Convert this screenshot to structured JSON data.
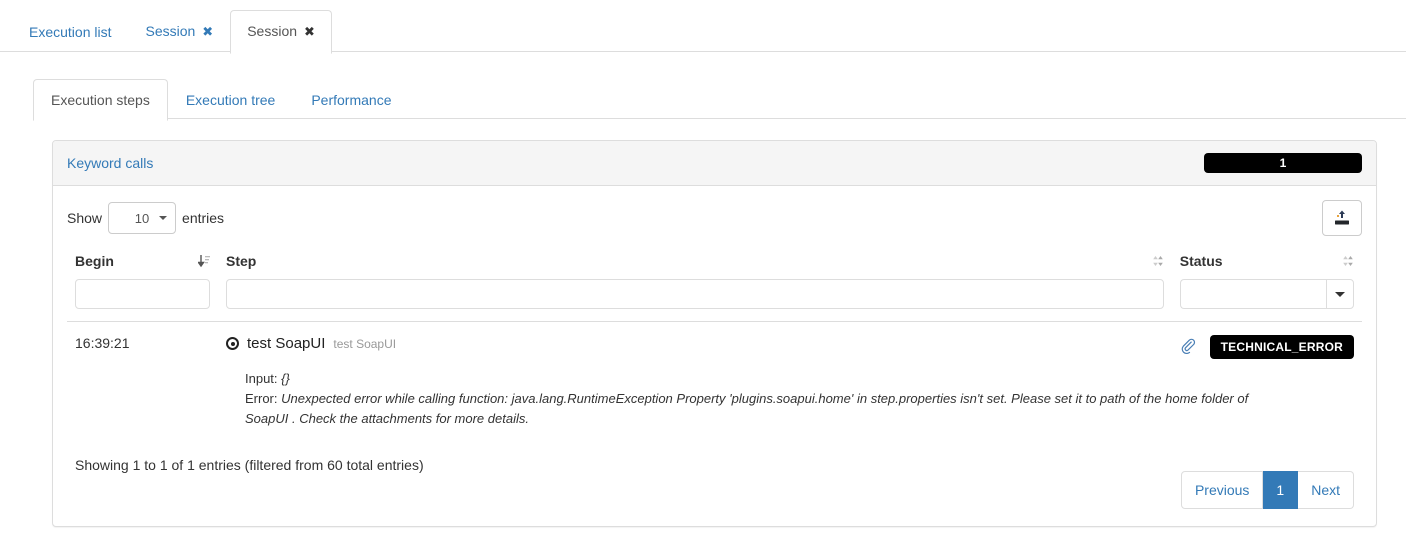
{
  "session_tabs": [
    {
      "label": "Execution list",
      "closable": false,
      "active": false
    },
    {
      "label": "Session",
      "closable": true,
      "active": false
    },
    {
      "label": "Session",
      "closable": true,
      "active": true
    }
  ],
  "tab_close_glyph": "✖",
  "inner_tabs": [
    {
      "label": "Execution steps",
      "active": true
    },
    {
      "label": "Execution tree",
      "active": false
    },
    {
      "label": "Performance",
      "active": false
    }
  ],
  "panel": {
    "title": "Keyword calls",
    "count_badge": "1"
  },
  "controls": {
    "show_label": "Show",
    "entries_label": "entries",
    "page_length": "10",
    "export_title": "Export"
  },
  "table": {
    "headers": {
      "begin": "Begin",
      "step": "Step",
      "status": "Status"
    },
    "filters": {
      "begin_value": "",
      "step_value": "",
      "status_value": ""
    },
    "rows": [
      {
        "begin": "16:39:21",
        "step_name": "test SoapUI",
        "step_sub": "test SoapUI",
        "status": "TECHNICAL_ERROR",
        "has_attachment": true,
        "input_label": "Input:",
        "input_value": "{}",
        "error_label": "Error:",
        "error_value": "Unexpected error while calling function: java.lang.RuntimeException Property 'plugins.soapui.home' in step.properties isn't set. Please set it to path of the home folder of SoapUI . Check the attachments for more details."
      }
    ]
  },
  "footer": {
    "info": "Showing 1 to 1 of 1 entries (filtered from 60 total entries)",
    "pagination": {
      "previous": "Previous",
      "page_1": "1",
      "next": "Next"
    }
  },
  "colors": {
    "link": "#337ab7",
    "badge_bg": "#000000",
    "active_page": "#337ab7",
    "panel_header_bg": "#f5f5f5",
    "border": "#dddddd"
  }
}
